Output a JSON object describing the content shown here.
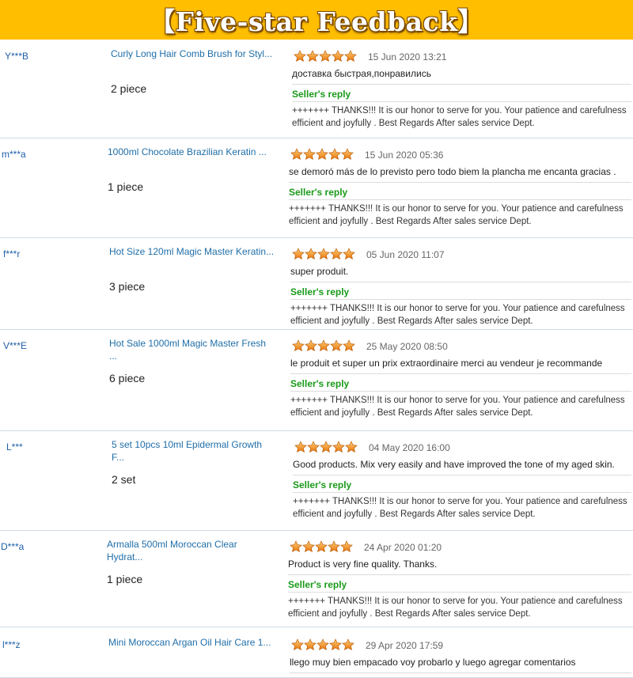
{
  "banner": {
    "title": "【Five-star Feedback】"
  },
  "colors": {
    "banner": "#ffbe00",
    "star": "#f39a1c",
    "reply_label": "#1a9a1a",
    "link": "#1f6ea8"
  },
  "reviews": [
    {
      "user": "Y***B",
      "product": "Curly Long Hair Comb Brush for Styl...",
      "product_line2": "",
      "quantity": "2 piece",
      "rating": 5,
      "date": "15 Jun 2020 13:21",
      "comment": "доставка быстрая,понравились",
      "reply_label": "Seller's reply",
      "reply_line1": "+++++++ THANKS!!! It is our honor to serve for you. Your patience and carefulness",
      "reply_line2": "efficient and joyfully . Best Regards After sales service Dept."
    },
    {
      "user": "m***a",
      "product": "1000ml Chocolate Brazilian Keratin ...",
      "product_line2": "",
      "quantity": "1 piece",
      "rating": 5,
      "date": "15 Jun 2020 05:36",
      "comment": "se demoró más de lo previsto pero todo biem la plancha me encanta gracias .",
      "reply_label": "Seller's reply",
      "reply_line1": "+++++++ THANKS!!! It is our honor to serve for you. Your patience and carefulness",
      "reply_line2": "efficient and joyfully . Best Regards After sales service Dept."
    },
    {
      "user": "f***r",
      "product": "Hot Size 120ml Magic Master Keratin...",
      "product_line2": "",
      "quantity": "3 piece",
      "rating": 5,
      "date": "05 Jun 2020 11:07",
      "comment": "super produit.",
      "reply_label": "Seller's reply",
      "reply_line1": "+++++++ THANKS!!! It is our honor to serve for you. Your patience and carefulness",
      "reply_line2": "efficient and joyfully . Best Regards After sales service Dept."
    },
    {
      "user": "V***E",
      "product": "Hot Sale 1000ml Magic Master Fresh",
      "product_line2": "...",
      "quantity": "6 piece",
      "rating": 5,
      "date": "25 May 2020 08:50",
      "comment": "le produit et super un prix extraordinaire merci au vendeur je recommande",
      "reply_label": "Seller's reply",
      "reply_line1": "+++++++ THANKS!!! It is our honor to serve for you. Your patience and carefulness",
      "reply_line2": "efficient and joyfully . Best Regards After sales service Dept."
    },
    {
      "user": "L***",
      "product": "5 set 10pcs 10ml Epidermal Growth",
      "product_line2": "F...",
      "quantity": "2 set",
      "rating": 5,
      "date": "04 May 2020 16:00",
      "comment": "Good products. Mix very easily and have improved the tone of my aged skin.",
      "reply_label": "Seller's reply",
      "reply_line1": "+++++++ THANKS!!! It is our honor to serve for you. Your patience and carefulness",
      "reply_line2": "efficient and joyfully . Best Regards After sales service Dept."
    },
    {
      "user": "D***a",
      "product": "Armalla 500ml Moroccan Clear",
      "product_line2": "Hydrat...",
      "quantity": "1 piece",
      "rating": 5,
      "date": "24 Apr 2020 01:20",
      "comment": "Product is very fine quality. Thanks.",
      "reply_label": "Seller's reply",
      "reply_line1": "+++++++ THANKS!!! It is our honor to serve for you. Your patience and carefulness",
      "reply_line2": "efficient and joyfully . Best Regards After sales service Dept."
    },
    {
      "user": "l***z",
      "product": "Mini Moroccan Argan Oil Hair Care 1...",
      "product_line2": "",
      "quantity": "",
      "rating": 5,
      "date": "29 Apr 2020 17:59",
      "comment": "llego muy bien empacado voy probarlo y luego agregar comentarios",
      "reply_label": "",
      "reply_line1": "",
      "reply_line2": ""
    }
  ]
}
